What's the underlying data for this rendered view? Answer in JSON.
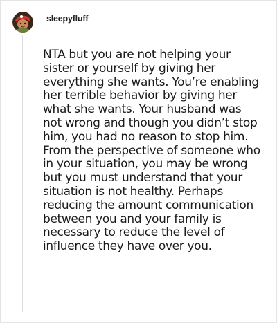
{
  "comment": {
    "author": {
      "username": "sleepyfluff",
      "avatar_icon": "cartoon-character-avatar-icon"
    },
    "body": "NTA but you are not helping your sister or yourself by giving her everything she wants. You’re enabling her terrible behavior by giving her what she wants. Your husband was not wrong and though you didn’t stop him, you had no reason to stop him. From the perspective of someone who in your situation, you may be wrong but you must understand that your situation is not healthy. Perhaps reducing the amount communication between you and your family is necessary to reduce the level of influence they have over you."
  },
  "colors": {
    "text": "#1a1a1a",
    "username": "#222222",
    "border": "#e4e4e4",
    "thread_line": "#dddddd",
    "avatar_bg": "#3b2418",
    "avatar_accent": "#d2342b"
  }
}
